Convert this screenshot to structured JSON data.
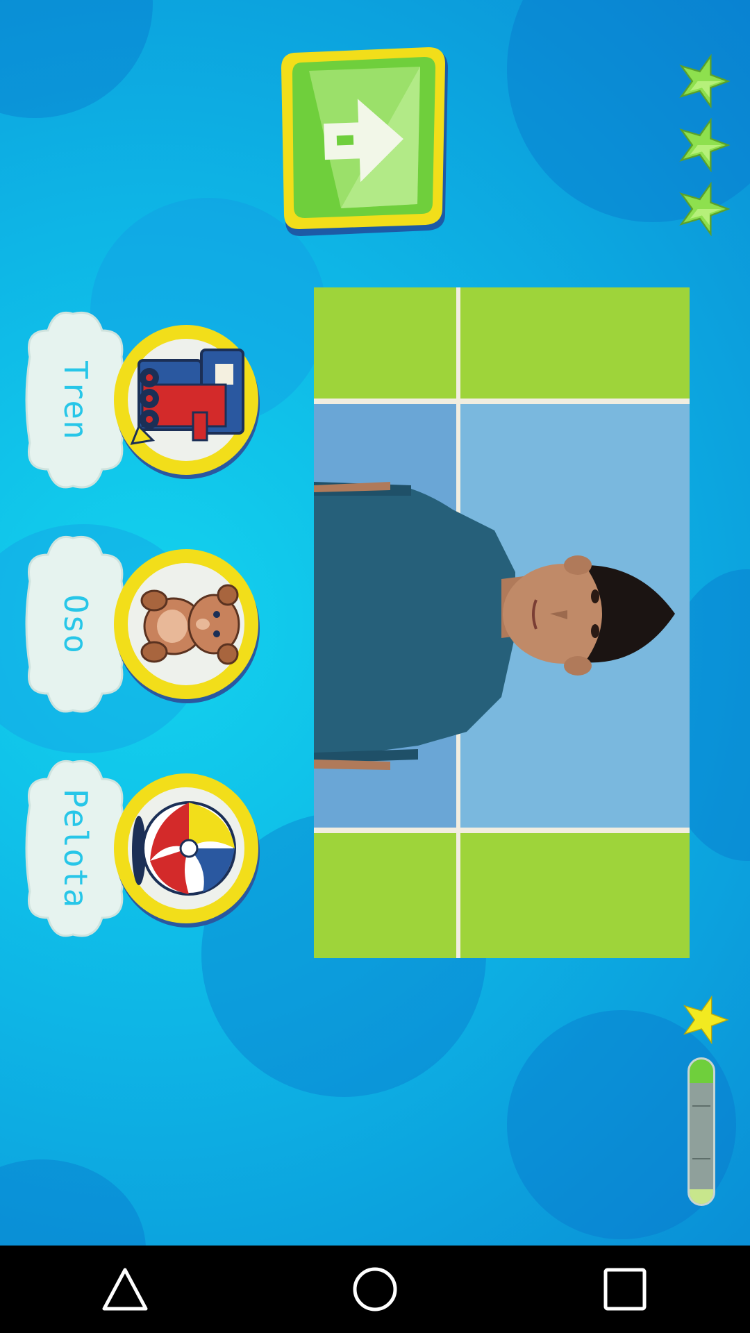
{
  "app": {
    "screen": "sign-language-quiz"
  },
  "score": {
    "stars_earned": 3,
    "star_color": "#8ee04e",
    "progress_fraction": 0.1
  },
  "next_button": {
    "icon": "arrow-right-icon",
    "color": "#7ed957"
  },
  "video": {
    "description_icon": "signer-video"
  },
  "options": [
    {
      "label": "Tren",
      "icon": "train-icon"
    },
    {
      "label": "Oso",
      "icon": "teddy-bear-icon"
    },
    {
      "label": "Pelota",
      "icon": "beach-ball-icon"
    }
  ],
  "navbar": {
    "back_icon": "back-triangle-icon",
    "home_icon": "home-circle-icon",
    "recents_icon": "recents-square-icon"
  },
  "colors": {
    "background": "#0eb6e6",
    "medal_ring": "#f2de1a",
    "cloud": "#e6f3ef",
    "label_text": "#27c6e8"
  }
}
